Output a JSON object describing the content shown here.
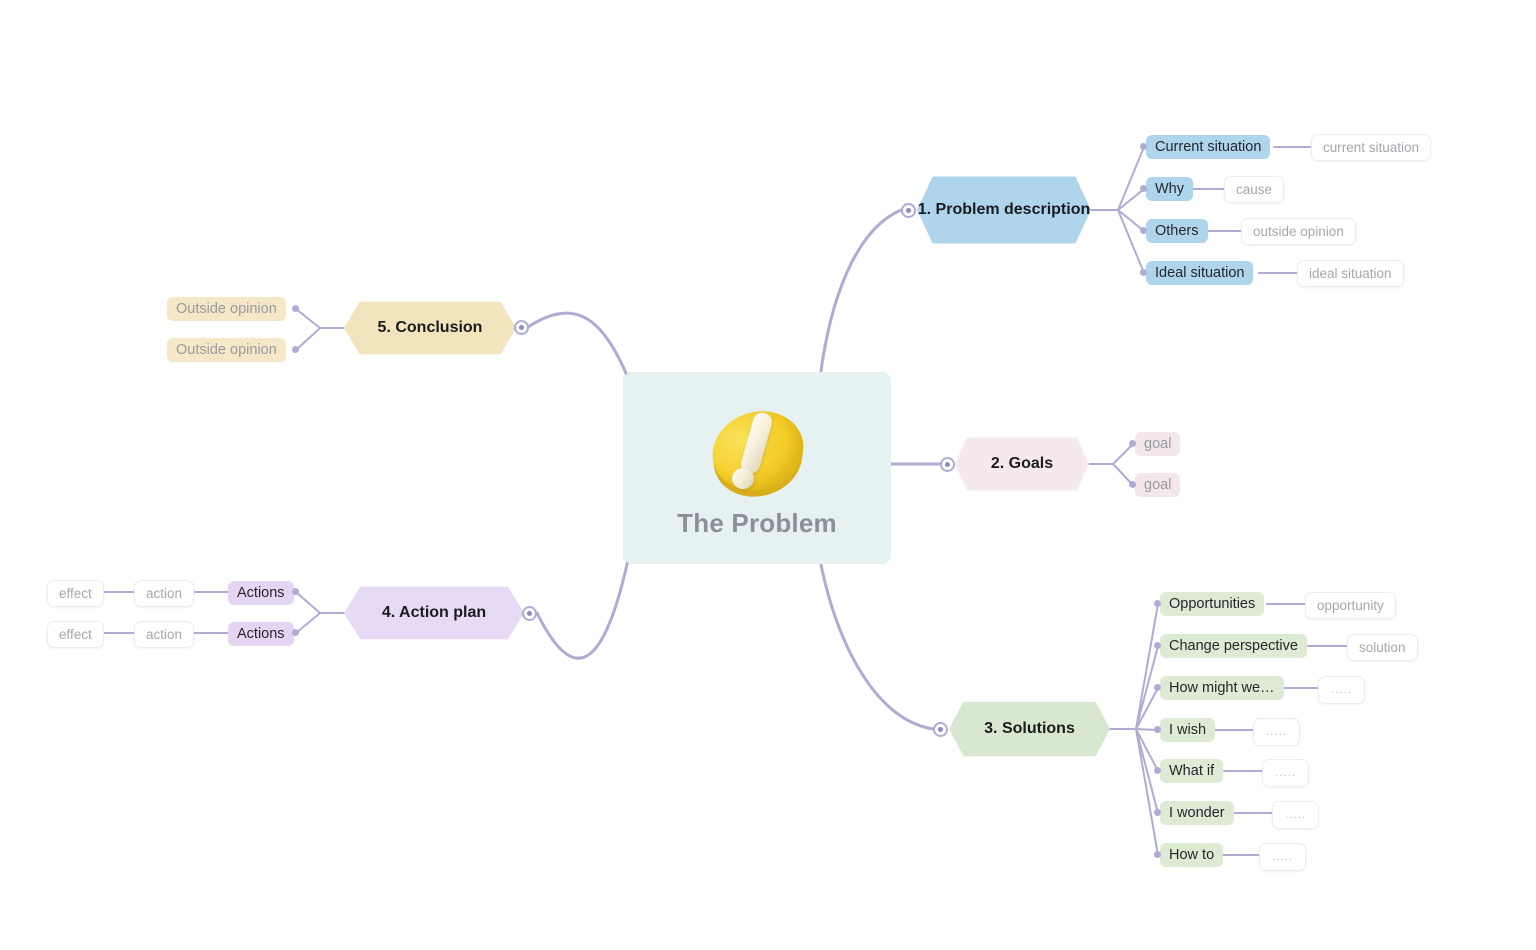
{
  "theme": {
    "connector_color": "#B0ABD4",
    "root_bg": "#E6F2F1",
    "root_text": "#8A9099",
    "leaf_bg": "#FFFFFF",
    "leaf_text": "#A6A6AE"
  },
  "root": {
    "label": "The Problem",
    "icon": "exclamation-mark-3d-icon"
  },
  "branches": [
    {
      "id": "problem-description",
      "number": "1.",
      "title": "Problem description",
      "color": "#AFD5EC",
      "subnode_color": "#AFD5EC",
      "side": "right",
      "children": [
        {
          "label": "Current situation",
          "leaf": "current situation"
        },
        {
          "label": "Why",
          "leaf": "cause"
        },
        {
          "label": "Others",
          "leaf": "outside opinion"
        },
        {
          "label": "Ideal situation",
          "leaf": "ideal situation"
        }
      ]
    },
    {
      "id": "goals",
      "number": "2.",
      "title": "Goals",
      "color": "#F6E9EC",
      "subnode_color": "#F3E7EA",
      "side": "right",
      "children": [
        {
          "label": "goal",
          "muted": true
        },
        {
          "label": "goal",
          "muted": true
        }
      ]
    },
    {
      "id": "solutions",
      "number": "3.",
      "title": "Solutions",
      "color": "#D7E7D0",
      "subnode_color": "#DDEBD5",
      "side": "right",
      "children": [
        {
          "label": "Opportunities",
          "leaf": "opportunity"
        },
        {
          "label": "Change perspective",
          "leaf": "solution"
        },
        {
          "label": "How might we…",
          "leaf": "....."
        },
        {
          "label": "I wish",
          "leaf": "....."
        },
        {
          "label": "What if",
          "leaf": "....."
        },
        {
          "label": "I wonder",
          "leaf": "....."
        },
        {
          "label": "How to",
          "leaf": "....."
        }
      ]
    },
    {
      "id": "action-plan",
      "number": "4.",
      "title": "Action plan",
      "color": "#E7DAF5",
      "subnode_color": "#E4D6F3",
      "side": "left",
      "children": [
        {
          "label": "Actions",
          "chain": [
            "action",
            "effect"
          ]
        },
        {
          "label": "Actions",
          "chain": [
            "action",
            "effect"
          ]
        }
      ]
    },
    {
      "id": "conclusion",
      "number": "5.",
      "title": "Conclusion",
      "color": "#F2E5BE",
      "subnode_color": "#F4E8C6",
      "side": "left",
      "children": [
        {
          "label": "Outside opinion",
          "muted": true
        },
        {
          "label": "Outside opinion",
          "muted": true
        }
      ]
    }
  ],
  "toggles": {
    "count": 5,
    "icon": "collapse-toggle-icon"
  }
}
